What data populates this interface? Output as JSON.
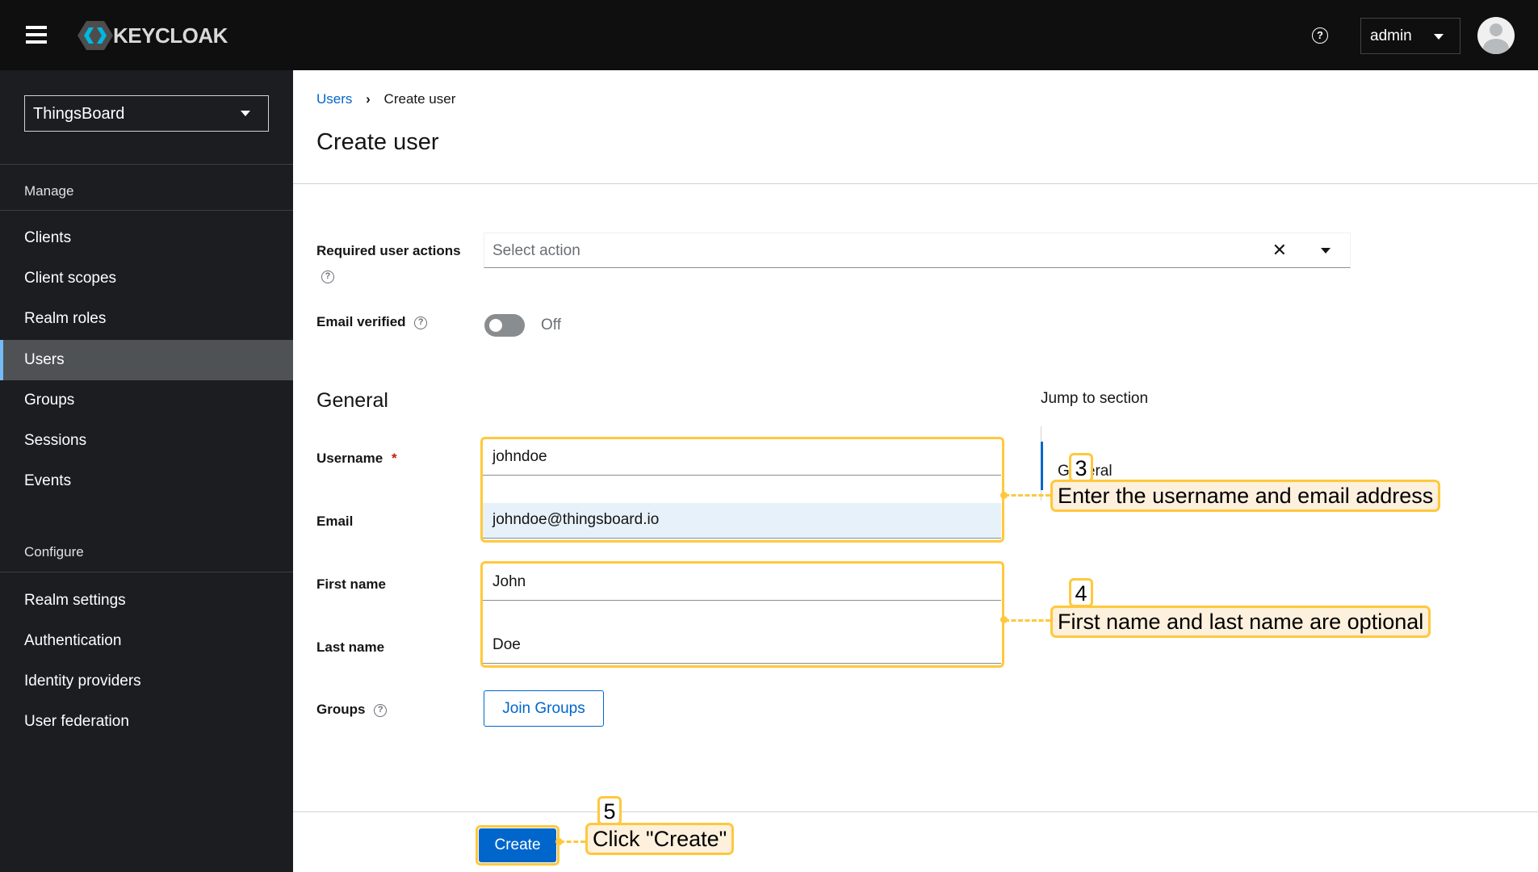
{
  "header": {
    "brand": "KEYCLOAK",
    "user": "admin",
    "icons": [
      "menu-icon",
      "help-icon",
      "caret-down-icon",
      "avatar-icon"
    ]
  },
  "sidebar": {
    "realm": "ThingsBoard",
    "manage_label": "Manage",
    "manage_items": [
      {
        "label": "Clients"
      },
      {
        "label": "Client scopes"
      },
      {
        "label": "Realm roles"
      },
      {
        "label": "Users",
        "active": true
      },
      {
        "label": "Groups"
      },
      {
        "label": "Sessions"
      },
      {
        "label": "Events"
      }
    ],
    "configure_label": "Configure",
    "configure_items": [
      {
        "label": "Realm settings"
      },
      {
        "label": "Authentication"
      },
      {
        "label": "Identity providers"
      },
      {
        "label": "User federation"
      }
    ]
  },
  "breadcrumb": {
    "parent": "Users",
    "current": "Create user"
  },
  "page_title": "Create user",
  "form": {
    "required_actions_label": "Required user actions",
    "required_actions_placeholder": "Select action",
    "email_verified_label": "Email verified",
    "email_verified_state": "Off",
    "general_heading": "General",
    "username_label": "Username",
    "required_mark": "*",
    "username_value": "johndoe",
    "email_label": "Email",
    "email_value": "johndoe@thingsboard.io",
    "first_name_label": "First name",
    "first_name_value": "John",
    "last_name_label": "Last name",
    "last_name_value": "Doe",
    "groups_label": "Groups",
    "join_groups": "Join Groups",
    "create": "Create"
  },
  "jump": {
    "title": "Jump to section",
    "item": "General"
  },
  "annotations": [
    {
      "step": "3",
      "text": "Enter the username and email address"
    },
    {
      "step": "4",
      "text": "First name and last name are optional"
    },
    {
      "step": "5",
      "text": "Click \"Create\""
    }
  ],
  "colors": {
    "accent": "#0066cc",
    "highlight": "#ffc83d",
    "sidebar": "#1b1d21"
  }
}
